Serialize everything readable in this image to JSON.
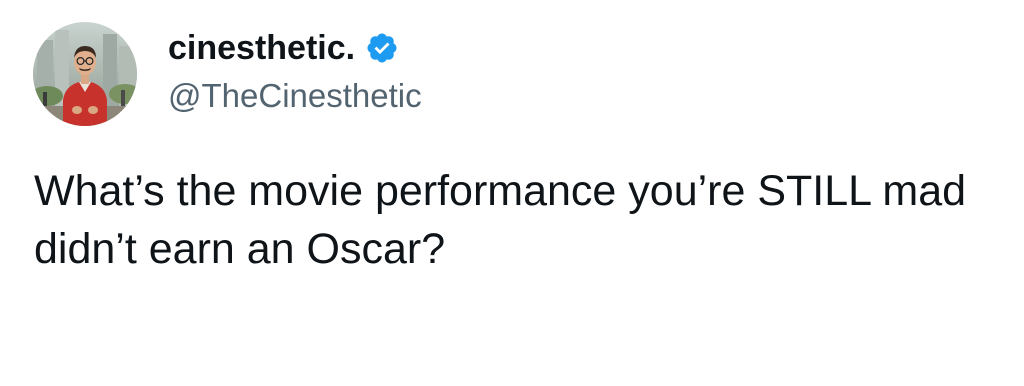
{
  "tweet": {
    "author": {
      "display_name": "cinesthetic.",
      "handle": "@TheCinesthetic",
      "verified": true,
      "verified_icon": "verified-badge-icon",
      "badge_color": "#1d9bf0"
    },
    "text": "What’s the movie performance you’re STILL mad didn’t earn an Oscar?"
  }
}
